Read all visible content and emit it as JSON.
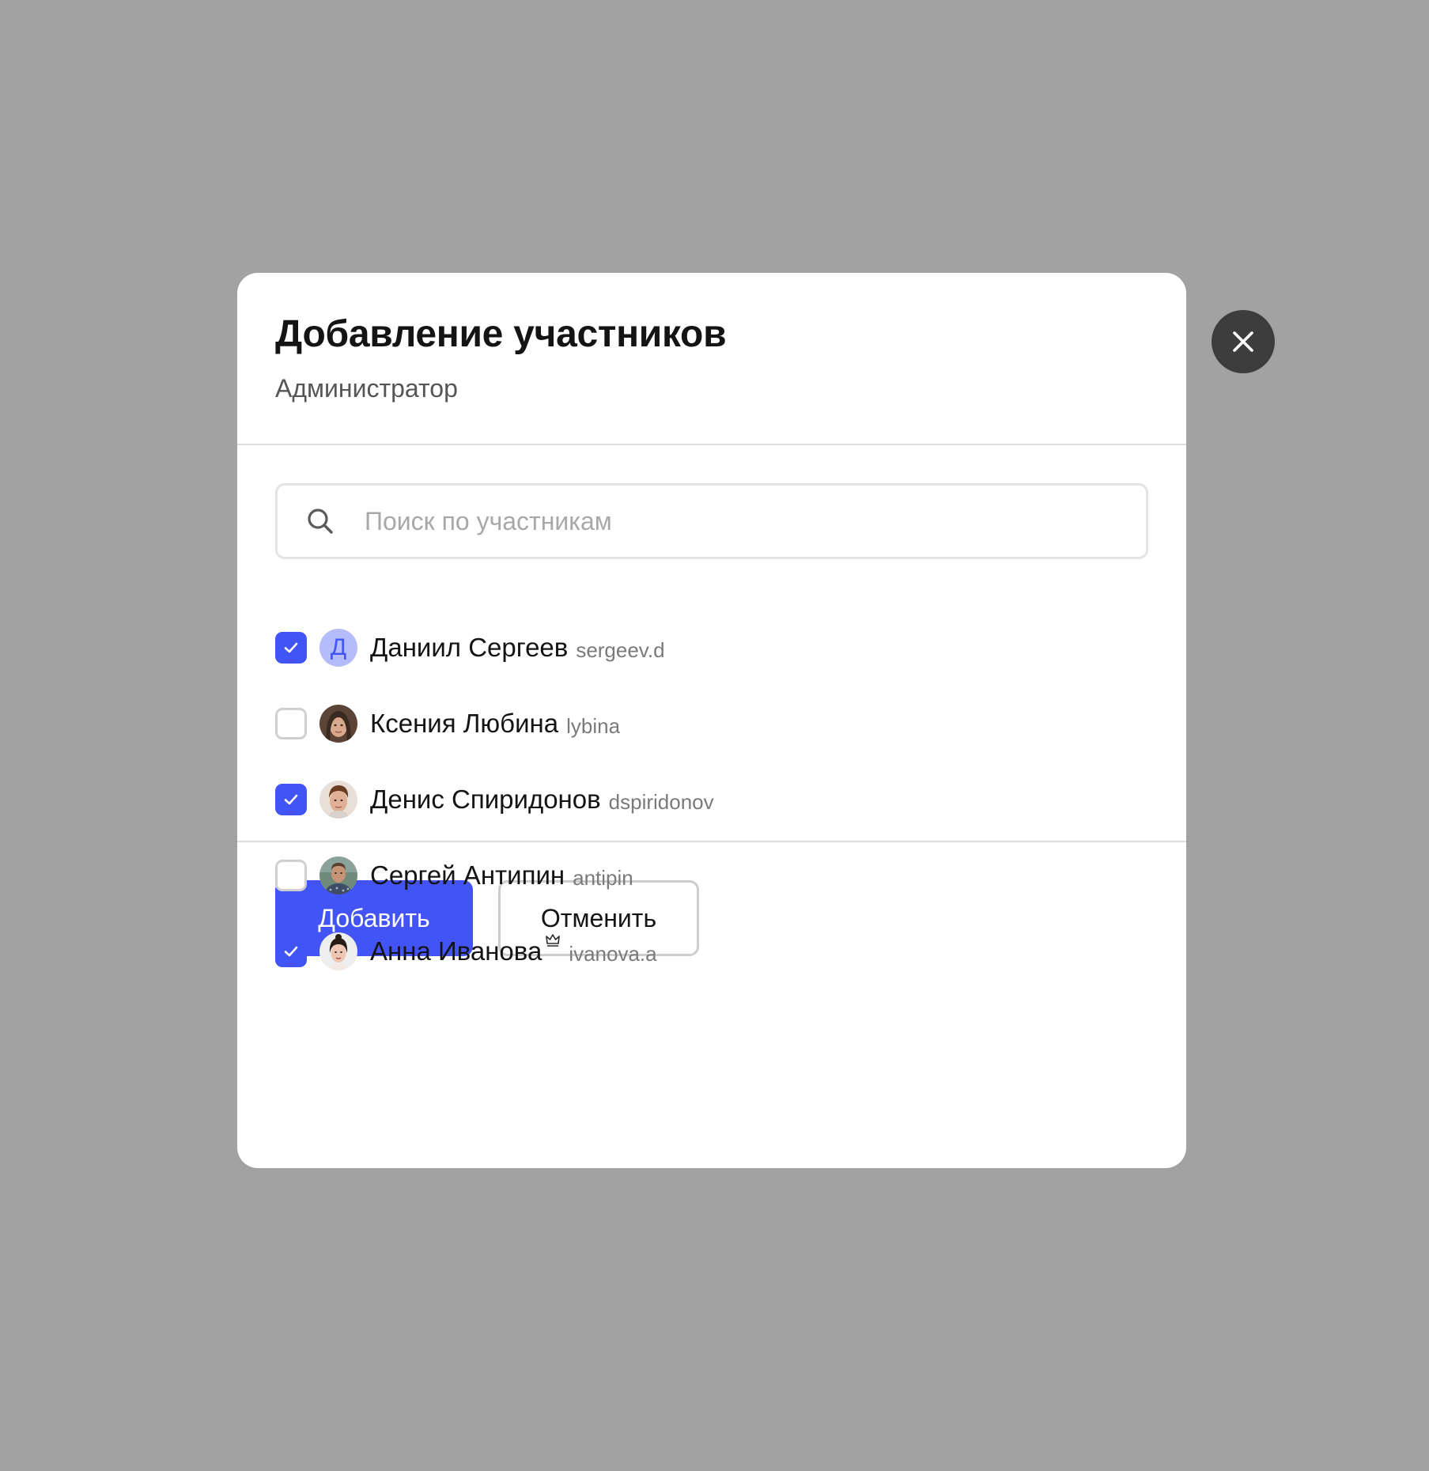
{
  "modal": {
    "title": "Добавление участников",
    "subtitle": "Администратор"
  },
  "search": {
    "placeholder": "Поиск по участникам",
    "value": ""
  },
  "members": [
    {
      "name": "Даниил Сергеев",
      "login": "sergeev.d",
      "checked": true,
      "avatar": "initial",
      "initial": "Д",
      "crown": false
    },
    {
      "name": "Ксения Любина",
      "login": "lybina",
      "checked": false,
      "avatar": "photo",
      "crown": false
    },
    {
      "name": "Денис Спиридонов",
      "login": "dspiridonov",
      "checked": true,
      "avatar": "photo",
      "crown": false
    },
    {
      "name": "Сергей Антипин",
      "login": "antipin",
      "checked": false,
      "avatar": "photo",
      "crown": false
    },
    {
      "name": "Анна Иванова",
      "login": "ivanova.a",
      "checked": true,
      "avatar": "photo",
      "crown": true
    }
  ],
  "footer": {
    "add_label": "Добавить",
    "cancel_label": "Отменить"
  },
  "icons": {
    "close": "close-icon",
    "search": "search-icon",
    "check": "check-icon",
    "crown": "crown-icon"
  },
  "colors": {
    "accent": "#4254f5",
    "overlay": "#a2a2a2",
    "close_bg": "#3d3d3d",
    "avatar_initial_bg": "#b5bcfb"
  }
}
